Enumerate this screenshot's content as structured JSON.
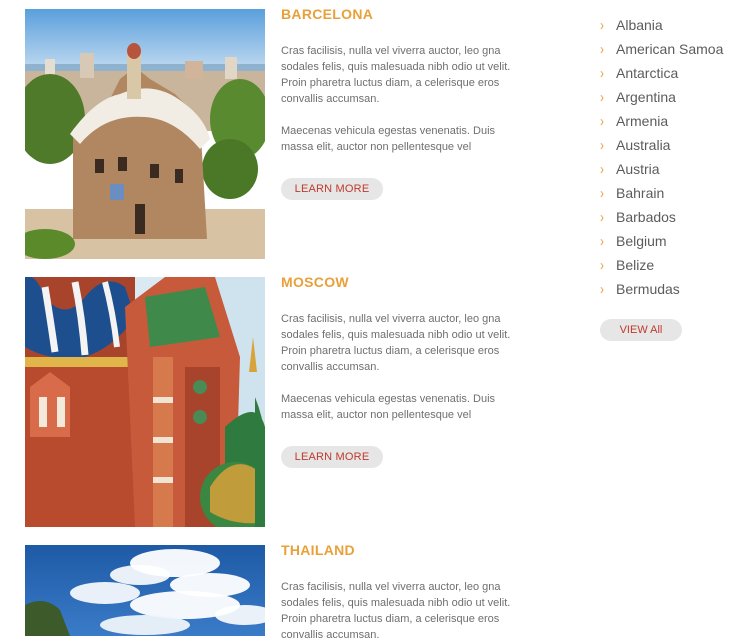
{
  "articles": [
    {
      "title": "BARCELONA",
      "para1": "Cras facilisis, nulla vel viverra auctor, leo gna sodales felis, quis malesuada nibh odio ut velit. Proin pharetra luctus diam, a celerisque eros convallis accumsan.",
      "para2": "Maecenas vehicula egestas venenatis. Duis massa elit, auctor non pellentesque vel",
      "button": "LEARN MORE"
    },
    {
      "title": "MOSCOW",
      "para1": "Cras facilisis, nulla vel viverra auctor, leo gna sodales felis, quis malesuada nibh odio ut velit. Proin pharetra luctus diam, a celerisque eros convallis accumsan.",
      "para2": "Maecenas vehicula egestas venenatis. Duis massa elit, auctor non pellentesque vel",
      "button": "LEARN MORE"
    },
    {
      "title": "THAILAND",
      "para1": "Cras facilisis, nulla vel viverra auctor, leo gna sodales felis, quis malesuada nibh odio ut velit. Proin pharetra luctus diam, a celerisque eros convallis accumsan."
    }
  ],
  "sidebar": {
    "countries": [
      "Albania",
      "American Samoa",
      "Antarctica",
      "Argentina",
      "Armenia",
      "Australia",
      "Austria",
      "Bahrain",
      "Barbados",
      "Belgium",
      "Belize",
      "Bermudas"
    ],
    "view_all": "VIEW All",
    "chevron_icon": "chevron-right-icon"
  },
  "colors": {
    "accent": "#e8a13a",
    "button_text": "#c0392b",
    "button_bg": "#e6e6e6",
    "body_text": "#6f6f6f"
  }
}
